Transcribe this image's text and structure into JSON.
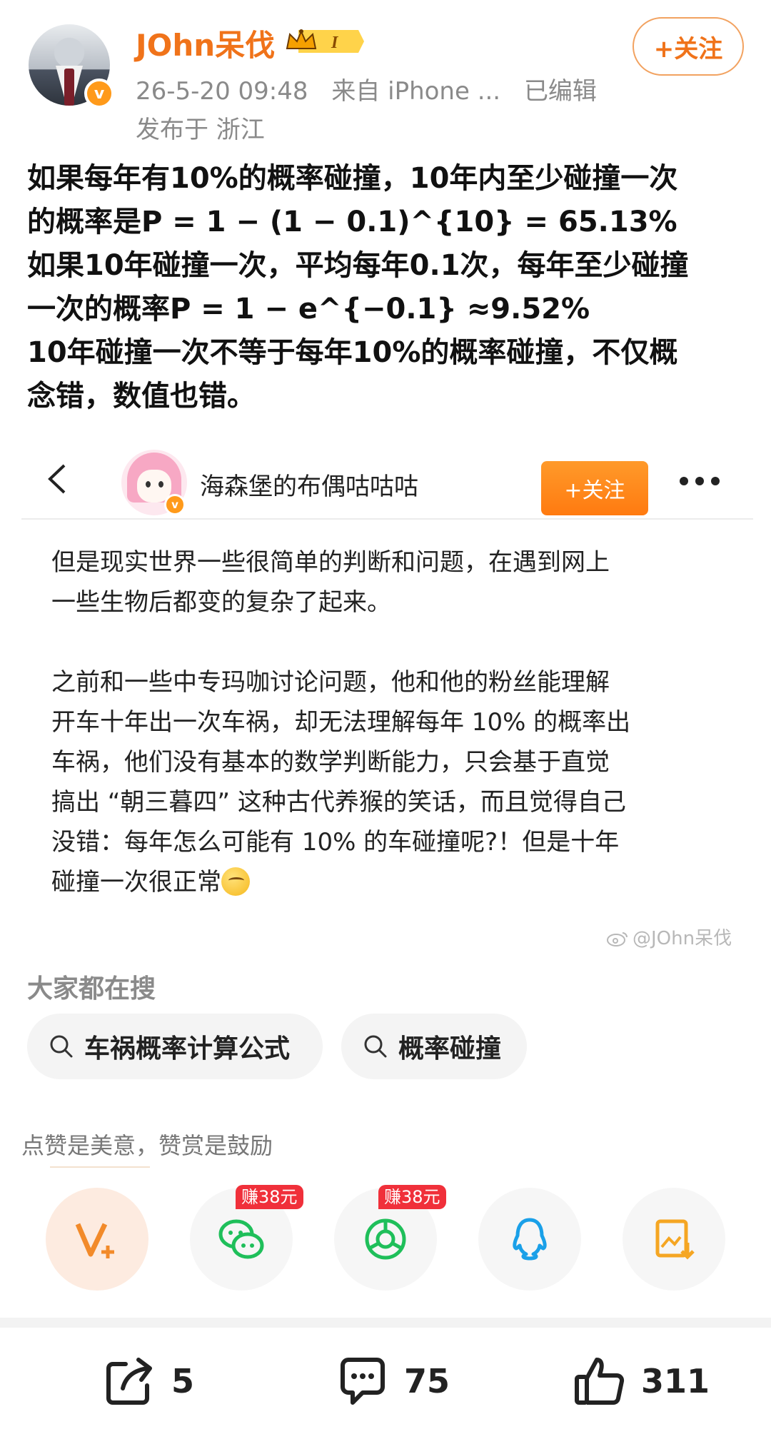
{
  "header": {
    "username": "JOhn呆伐",
    "vip_level": "I",
    "verified_mark": "v",
    "time": "26-5-20 09:48",
    "source": "来自 iPhone ...",
    "edited": "已编辑",
    "location": "发布于 浙江",
    "follow_label": "+关注"
  },
  "post": {
    "lines": [
      "如果每年有10%的概率碰撞，10年内至少碰撞一次",
      "的概率是P = 1 − (1 − 0.1)^{10} = 65.13%",
      "如果10年碰撞一次，平均每年0.1次，每年至少碰撞",
      "一次的概率P =  1 − e^{−0.1} ≈9.52%",
      "10年碰撞一次不等于每年10%的概率碰撞，不仅概",
      "念错，数值也错。"
    ]
  },
  "embed": {
    "name": "海森堡的布偶咕咕咕",
    "verified_mark": "v",
    "follow_label": "+关注",
    "para1": [
      "但是现实世界一些很简单的判断和问题，在遇到网上",
      "一些生物后都变的复杂了起来。"
    ],
    "para2": [
      "之前和一些中专玛咖讨论问题，他和他的粉丝能理解",
      "开车十年出一次车祸，却无法理解每年 10% 的概率出",
      "车祸，他们没有基本的数学判断能力，只会基于直觉",
      "搞出 “朝三暮四” 这种古代养猴的笑话，而且觉得自己",
      "没错：每年怎么可能有 10% 的车碰撞呢?！但是十年",
      "碰撞一次很正常"
    ],
    "watermark": "@JOhn呆伐"
  },
  "search": {
    "title": "大家都在搜",
    "chips": [
      "车祸概率计算公式",
      "概率碰撞"
    ]
  },
  "reward": {
    "text": "点赞是美意，赞赏是鼓励",
    "earn_tags": [
      "赚38元",
      "赚38元"
    ]
  },
  "bottom": {
    "share_count": "5",
    "comment_count": "75",
    "like_count": "311"
  },
  "colors": {
    "accent": "#f0731a",
    "badge": "#ff9a1a",
    "earn": "#f0303a",
    "wechat": "#1fbf5a",
    "qq": "#1aa0e8"
  }
}
